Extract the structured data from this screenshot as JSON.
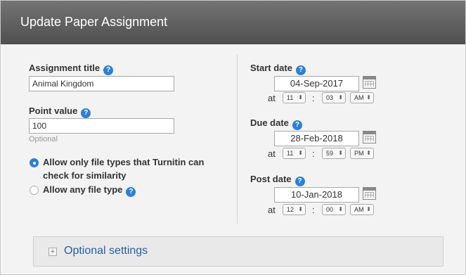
{
  "header": {
    "title": "Update Paper Assignment"
  },
  "assignment_title": {
    "label": "Assignment title",
    "value": "Animal Kingdom",
    "help_icon": "question-mark"
  },
  "point_value": {
    "label": "Point value",
    "value": "100",
    "hint": "Optional",
    "help_icon": "question-mark"
  },
  "file_types": {
    "option1": {
      "label_line1": "Allow only file types that Turnitin can",
      "label_line2": "check for similarity",
      "selected": true
    },
    "option2": {
      "label": "Allow any file type",
      "selected": false
    }
  },
  "start_date": {
    "label": "Start date",
    "date": "04-Sep-2017",
    "at": "at",
    "hour": "11",
    "minute": "03",
    "ampm": "AM"
  },
  "due_date": {
    "label": "Due date",
    "date": "28-Feb-2018",
    "at": "at",
    "hour": "11",
    "minute": "59",
    "ampm": "PM"
  },
  "post_date": {
    "label": "Post date",
    "date": "10-Jan-2018",
    "at": "at",
    "hour": "12",
    "minute": "00",
    "ampm": "AM"
  },
  "time_separator": ":",
  "optional_settings": {
    "label": "Optional settings",
    "expand_symbol": "+"
  },
  "colors": {
    "accent": "#2f7fd3",
    "header_top": "#747474",
    "header_bottom": "#4f4f4f",
    "link": "#2a5f9e"
  }
}
